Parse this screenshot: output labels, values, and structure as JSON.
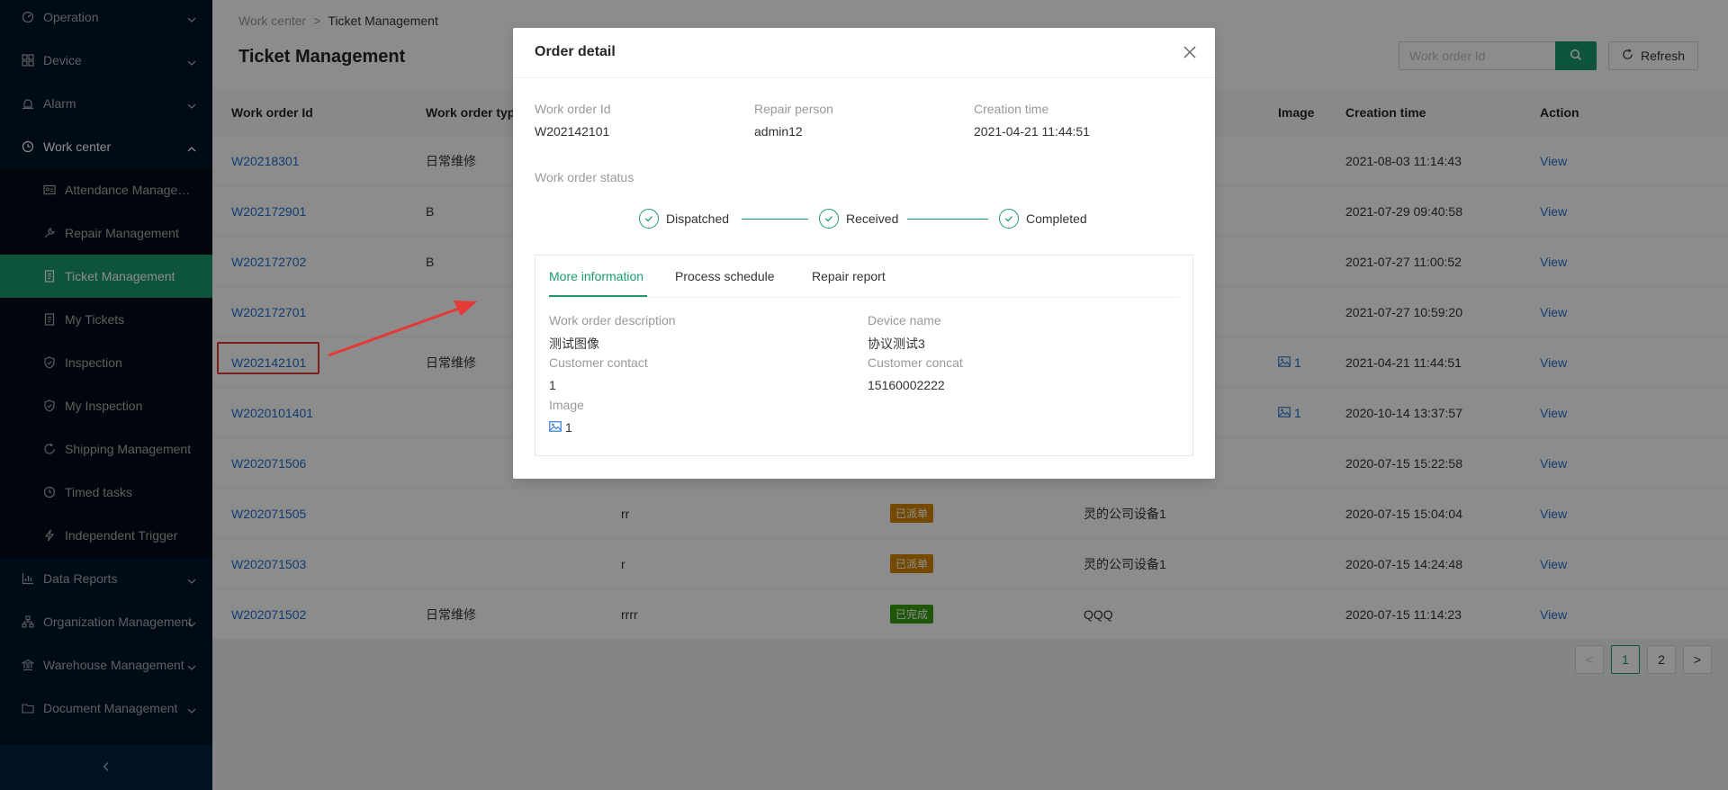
{
  "sidebar": {
    "items": [
      {
        "label": "Operation",
        "icon": "dashboard-icon"
      },
      {
        "label": "Device",
        "icon": "grid-icon"
      },
      {
        "label": "Alarm",
        "icon": "alarm-icon"
      },
      {
        "label": "Work center",
        "icon": "clock-icon"
      },
      {
        "label": "Attendance Management",
        "icon": "id-card-icon"
      },
      {
        "label": "Repair Management",
        "icon": "wrench-icon"
      },
      {
        "label": "Ticket Management",
        "icon": "document-icon"
      },
      {
        "label": "My Tickets",
        "icon": "document-icon"
      },
      {
        "label": "Inspection",
        "icon": "shield-icon"
      },
      {
        "label": "My Inspection",
        "icon": "shield-icon"
      },
      {
        "label": "Shipping Management",
        "icon": "refresh-icon"
      },
      {
        "label": "Timed tasks",
        "icon": "clock-icon"
      },
      {
        "label": "Independent Trigger",
        "icon": "lightning-icon"
      },
      {
        "label": "Data Reports",
        "icon": "bar-chart-icon"
      },
      {
        "label": "Organization Management",
        "icon": "org-icon"
      },
      {
        "label": "Warehouse Management",
        "icon": "bank-icon"
      },
      {
        "label": "Document Management",
        "icon": "folder-icon"
      }
    ],
    "collapse_icon": "chevron-left-icon"
  },
  "header": {
    "breadcrumb": [
      "Work center",
      "Ticket Management"
    ],
    "breadcrumb_sep": ">",
    "title": "Ticket Management",
    "search_placeholder": "Work order Id",
    "refresh_label": "Refresh"
  },
  "table": {
    "columns": [
      "Work order Id",
      "Work order type",
      "Image",
      "Creation time",
      "Action"
    ],
    "rows": [
      {
        "id": "W20218301",
        "type": "日常维修",
        "desc": "",
        "status": "",
        "device": "",
        "image": "",
        "time": "2021-08-03 11:14:43",
        "action": "View"
      },
      {
        "id": "W202172901",
        "type": "B",
        "desc": "",
        "status": "",
        "device": "",
        "image": "",
        "time": "2021-07-29 09:40:58",
        "action": "View"
      },
      {
        "id": "W202172702",
        "type": "B",
        "desc": "",
        "status": "",
        "device": "",
        "image": "",
        "time": "2021-07-27 11:00:52",
        "action": "View"
      },
      {
        "id": "W202172701",
        "type": "",
        "desc": "",
        "status": "",
        "device": "",
        "image": "",
        "time": "2021-07-27 10:59:20",
        "action": "View"
      },
      {
        "id": "W202142101",
        "type": "日常维修",
        "desc": "",
        "status": "",
        "device": "",
        "image": "1",
        "time": "2021-04-21 11:44:51",
        "action": "View"
      },
      {
        "id": "W2020101401",
        "type": "",
        "desc": "",
        "status": "",
        "device": "",
        "image": "1",
        "time": "2020-10-14 13:37:57",
        "action": "View"
      },
      {
        "id": "W202071506",
        "type": "",
        "desc": "",
        "status": "",
        "device": "",
        "image": "",
        "time": "2020-07-15 15:22:58",
        "action": "View"
      },
      {
        "id": "W202071505",
        "type": "",
        "desc": "rr",
        "status": "已派单",
        "device": "灵的公司设备1",
        "image": "",
        "time": "2020-07-15 15:04:04",
        "action": "View"
      },
      {
        "id": "W202071503",
        "type": "",
        "desc": "r",
        "status": "已派单",
        "device": "灵的公司设备1",
        "image": "",
        "time": "2020-07-15 14:24:48",
        "action": "View"
      },
      {
        "id": "W202071502",
        "type": "日常维修",
        "desc": "rrrr",
        "status": "已完成",
        "device": "QQQ",
        "image": "",
        "time": "2020-07-15 11:14:23",
        "action": "View"
      }
    ]
  },
  "pagination": {
    "prev": "<",
    "pages": [
      "1",
      "2"
    ],
    "current": "1",
    "next": ">"
  },
  "modal": {
    "title": "Order detail",
    "fields": {
      "work_order_id_label": "Work order Id",
      "work_order_id": "W202142101",
      "repair_person_label": "Repair person",
      "repair_person": "admin12",
      "creation_time_label": "Creation time",
      "creation_time": "2021-04-21 11:44:51"
    },
    "status_label": "Work order status",
    "steps": [
      "Dispatched",
      "Received",
      "Completed"
    ],
    "tabs": [
      "More information",
      "Process schedule",
      "Repair report"
    ],
    "active_tab": "More information",
    "info": {
      "description_label": "Work order description",
      "description": "测试图像",
      "device_label": "Device name",
      "device": "协议测试3",
      "contact_label": "Customer contact",
      "contact": "1",
      "concat_label": "Customer concat",
      "concat": "15160002222",
      "image_label": "Image",
      "image_count": "1"
    }
  },
  "colors": {
    "accent": "#1a9a6c",
    "link": "#1f6fd0",
    "annotation": "#e53935",
    "sidebar_bg": "#001529"
  }
}
